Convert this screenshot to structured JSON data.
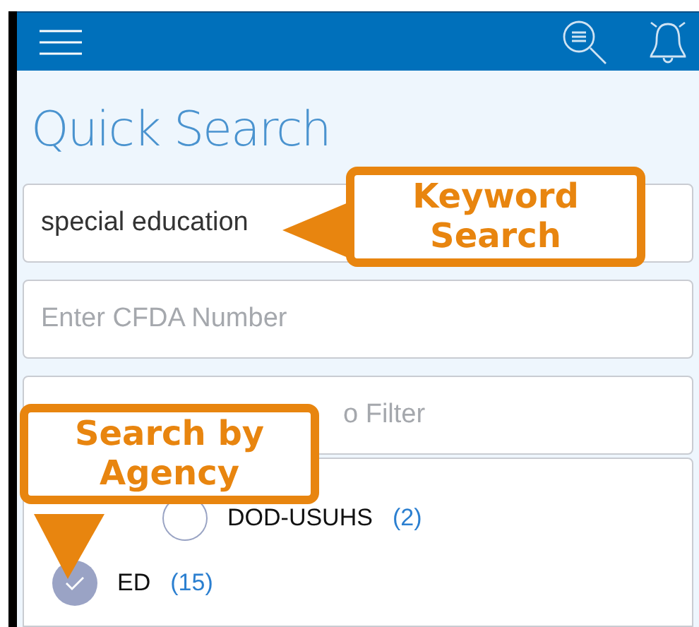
{
  "header": {
    "title": "Quick Search"
  },
  "fields": [
    {
      "kind": "value",
      "text": "special education"
    },
    {
      "kind": "placeholder",
      "text": "Enter CFDA Number"
    },
    {
      "kind": "placeholder",
      "text": "o Filter"
    }
  ],
  "agencies": [
    {
      "name": "DOD-USUHS",
      "count": "(2)",
      "checked": false,
      "nested": true
    },
    {
      "name": "ED",
      "count": "(15)",
      "checked": true,
      "nested": false
    }
  ],
  "callouts": [
    {
      "text": "Keyword Search",
      "kind": "side"
    },
    {
      "text": "Search by Agency",
      "kind": "bottom"
    }
  ]
}
